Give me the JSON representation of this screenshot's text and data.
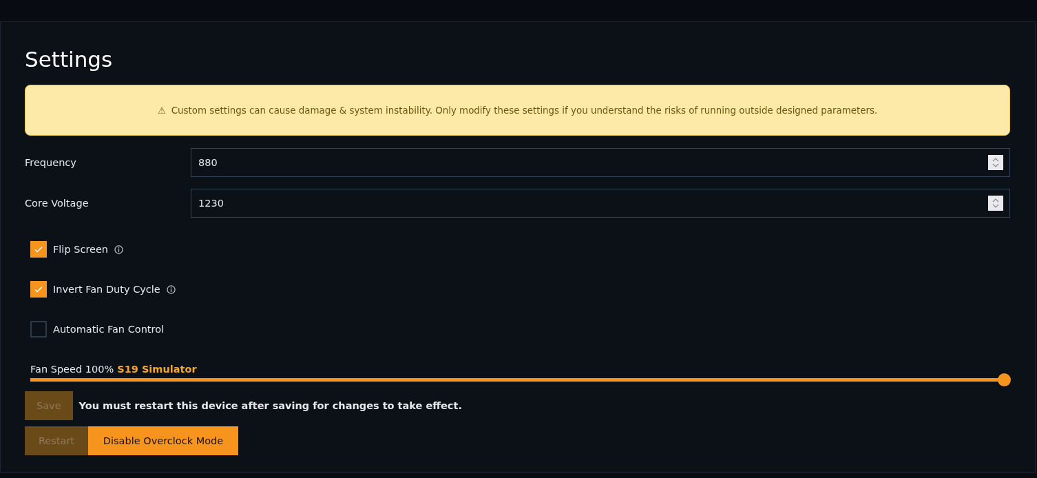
{
  "title": "Settings",
  "warning": {
    "icon": "⚠",
    "text": "Custom settings can cause damage & system instability. Only modify these settings if you understand the risks of running outside designed parameters."
  },
  "fields": [
    {
      "label": "Frequency",
      "value": "880"
    },
    {
      "label": "Core Voltage",
      "value": "1230"
    }
  ],
  "checkboxes": [
    {
      "label": "Flip Screen",
      "checked": true,
      "info": true
    },
    {
      "label": "Invert Fan Duty Cycle",
      "checked": true,
      "info": true
    },
    {
      "label": "Automatic Fan Control",
      "checked": false,
      "info": false
    }
  ],
  "fan_speed": {
    "label": "Fan Speed 100%",
    "device": "S19 Simulator",
    "level": 1
  },
  "save": {
    "label": "Save",
    "disabled": true,
    "note": "You must restart this device after saving for changes to take effect."
  },
  "buttons": [
    {
      "label": "Restart",
      "disabled": true
    },
    {
      "label": "Disable Overclock Mode",
      "disabled": false
    }
  ]
}
